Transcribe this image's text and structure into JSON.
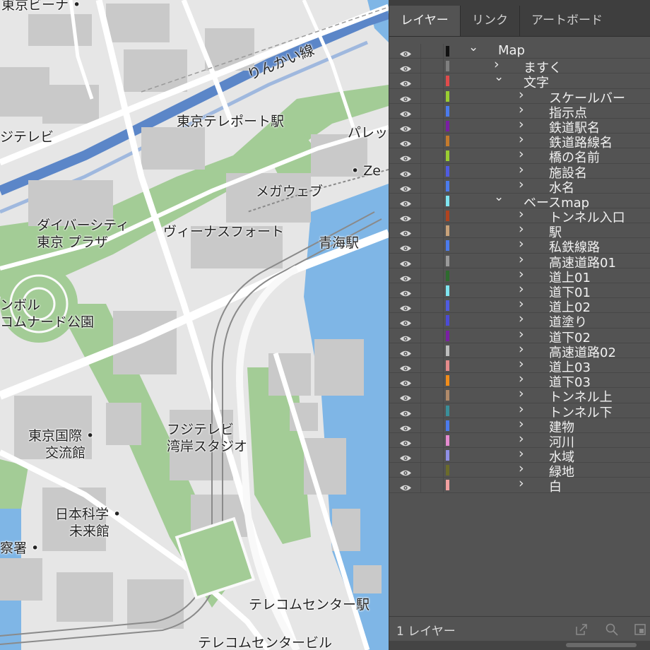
{
  "map": {
    "labels": [
      {
        "id": "tokyo-venus",
        "text": "東京ビーナ •"
      },
      {
        "id": "rinkai-line",
        "text": "りんかい線"
      },
      {
        "id": "fuji-tv",
        "text": "ジテレビ"
      },
      {
        "id": "teleport-station",
        "text": "東京テレポート駅"
      },
      {
        "id": "palette",
        "text": "パレッ"
      },
      {
        "id": "zepp",
        "text": "• Ze"
      },
      {
        "id": "megaweb",
        "text": "メガウェブ"
      },
      {
        "id": "divercity-1",
        "text": "ダイバーシティ"
      },
      {
        "id": "divercity-2",
        "text": "東京 プラザ"
      },
      {
        "id": "venusfort",
        "text": "ヴィーナスフォート"
      },
      {
        "id": "aomi-station",
        "text": "青海駅"
      },
      {
        "id": "symbol-1",
        "text": "ンボル"
      },
      {
        "id": "symbol-2",
        "text": "コムナード公園"
      },
      {
        "id": "kokusai-1",
        "text": "東京国際 •"
      },
      {
        "id": "kokusai-2",
        "text": "交流館"
      },
      {
        "id": "fujitv-studio-1",
        "text": "フジテレビ"
      },
      {
        "id": "fujitv-studio-2",
        "text": "湾岸スタジオ"
      },
      {
        "id": "miraikan-1",
        "text": "日本科学 •"
      },
      {
        "id": "miraikan-2",
        "text": "未来館"
      },
      {
        "id": "police",
        "text": "察署 •"
      },
      {
        "id": "telecom-station",
        "text": "テレコムセンター駅"
      },
      {
        "id": "telecom-building",
        "text": "テレコムセンタービル"
      }
    ]
  },
  "panel": {
    "tabs": [
      "レイヤー",
      "リンク",
      "アートボード"
    ],
    "layers": [
      {
        "name": "Map",
        "color": "#111111",
        "level": 0,
        "expanded": true
      },
      {
        "name": "ますく",
        "color": "#7f7f7f",
        "level": 1,
        "expanded": false
      },
      {
        "name": "文字",
        "color": "#e04b4b",
        "level": 1,
        "expanded": true
      },
      {
        "name": "スケールバー",
        "color": "#9acd32",
        "level": 2,
        "expanded": false
      },
      {
        "name": "指示点",
        "color": "#4b7bec",
        "level": 2,
        "expanded": false
      },
      {
        "name": "鉄道駅名",
        "color": "#7a1fa2",
        "level": 2,
        "expanded": false
      },
      {
        "name": "鉄道路線名",
        "color": "#c47a2c",
        "level": 2,
        "expanded": false
      },
      {
        "name": "橋の名前",
        "color": "#9acd32",
        "level": 2,
        "expanded": false
      },
      {
        "name": "施設名",
        "color": "#4f5ce0",
        "level": 2,
        "expanded": false
      },
      {
        "name": "水名",
        "color": "#4b7bec",
        "level": 2,
        "expanded": false
      },
      {
        "name": "ベースmap",
        "color": "#7fe5f0",
        "level": 1,
        "expanded": true
      },
      {
        "name": "トンネル入口",
        "color": "#b0431f",
        "level": 2,
        "expanded": false
      },
      {
        "name": "駅",
        "color": "#c8a27a",
        "level": 2,
        "expanded": false
      },
      {
        "name": "私鉄線路",
        "color": "#4b7bec",
        "level": 2,
        "expanded": false
      },
      {
        "name": "高速道路01",
        "color": "#9a9a9a",
        "level": 2,
        "expanded": false
      },
      {
        "name": "道上01",
        "color": "#2e6b2e",
        "level": 2,
        "expanded": false
      },
      {
        "name": "道下01",
        "color": "#7fe5f0",
        "level": 2,
        "expanded": false
      },
      {
        "name": "道上02",
        "color": "#4f5ce0",
        "level": 2,
        "expanded": false
      },
      {
        "name": "道塗り",
        "color": "#4b4bd6",
        "level": 2,
        "expanded": false
      },
      {
        "name": "道下02",
        "color": "#7a1fa2",
        "level": 2,
        "expanded": false
      },
      {
        "name": "高速道路02",
        "color": "#bdbdbd",
        "level": 2,
        "expanded": false
      },
      {
        "name": "道上03",
        "color": "#e58b8b",
        "level": 2,
        "expanded": false
      },
      {
        "name": "道下03",
        "color": "#f08c1a",
        "level": 2,
        "expanded": false
      },
      {
        "name": "トンネル上",
        "color": "#b08a6a",
        "level": 2,
        "expanded": false
      },
      {
        "name": "トンネル下",
        "color": "#3a8f9a",
        "level": 2,
        "expanded": false
      },
      {
        "name": "建物",
        "color": "#4b7bec",
        "level": 2,
        "expanded": false
      },
      {
        "name": "河川",
        "color": "#e58bd0",
        "level": 2,
        "expanded": false
      },
      {
        "name": "水域",
        "color": "#8f8fe6",
        "level": 2,
        "expanded": false
      },
      {
        "name": "緑地",
        "color": "#6b6b2a",
        "level": 2,
        "expanded": false
      },
      {
        "name": "白",
        "color": "#f2a0a0",
        "level": 2,
        "expanded": false
      }
    ],
    "footer": {
      "count_label": "1 レイヤー"
    }
  }
}
